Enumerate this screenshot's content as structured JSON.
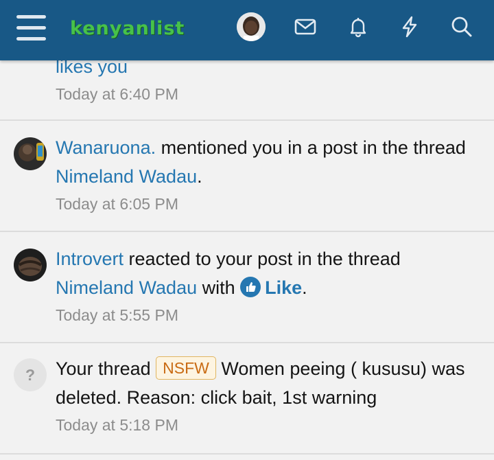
{
  "header": {
    "logo_text": "kenyanlist",
    "nav_icons": [
      "menu-icon",
      "avatar",
      "envelope-icon",
      "bell-icon",
      "bolt-icon",
      "search-icon"
    ]
  },
  "notifications": [
    {
      "pre": "",
      "user": "",
      "partial_text": "likes you",
      "time": "Today at 6:40 PM"
    },
    {
      "user": "Wanaruona.",
      "text1": " mentioned you in a post in the thread ",
      "thread": "Nimeland Wadau",
      "text2": ".",
      "time": "Today at 6:05 PM"
    },
    {
      "user": "Introvert",
      "text1": " reacted to your post in the thread ",
      "thread": "Nimeland Wadau",
      "text2": " with ",
      "reaction": "Like",
      "text3": ".",
      "time": "Today at 5:55 PM"
    },
    {
      "avatar_placeholder": "?",
      "text1": "Your thread ",
      "prefix_badge": "NSFW",
      "text2": " Women peeing ( kususu) was deleted. Reason: click bait, 1st warning",
      "time": "Today at 5:18 PM"
    }
  ],
  "colors": {
    "header_bg": "#185886",
    "link": "#2577b1",
    "logo": "#47c24a",
    "badge_text": "#c96b13"
  }
}
